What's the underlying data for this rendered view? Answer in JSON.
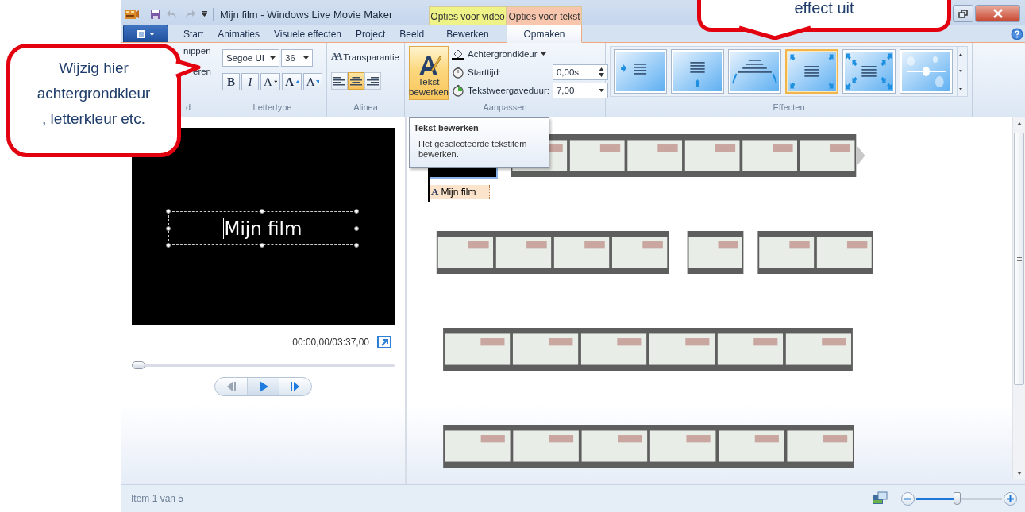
{
  "window": {
    "title": "Mijn film - Windows Live Movie Maker"
  },
  "context_tabs": [
    {
      "label": "Opties voor video",
      "color": "#eef287"
    },
    {
      "label": "Opties voor tekst",
      "color": "#f7c6ad"
    }
  ],
  "tabs": [
    {
      "label": "Start",
      "selected": false
    },
    {
      "label": "Animaties",
      "selected": false
    },
    {
      "label": "Visuele effecten",
      "selected": false
    },
    {
      "label": "Project",
      "selected": false
    },
    {
      "label": "Beeld",
      "selected": false
    },
    {
      "label": "Bewerken",
      "selected": false
    },
    {
      "label": "Opmaken",
      "selected": true
    }
  ],
  "ribbon": {
    "clipboard": {
      "commands": [
        "nippen",
        "eren"
      ],
      "label": "d"
    },
    "font": {
      "family": "Segoe UI",
      "size": "36",
      "format_buttons": [
        {
          "kind": "bold",
          "glyph": "B"
        },
        {
          "kind": "italic",
          "glyph": "I"
        },
        {
          "kind": "font-color",
          "glyph": "A"
        },
        {
          "kind": "grow",
          "glyph": "A"
        },
        {
          "kind": "shrink",
          "glyph": "A"
        }
      ],
      "label": "Lettertype"
    },
    "paragraph": {
      "transparency": {
        "icon": "AA",
        "label": "Transparantie"
      },
      "alignments": [
        {
          "kind": "left",
          "selected": false
        },
        {
          "kind": "center",
          "selected": true
        },
        {
          "kind": "right",
          "selected": false
        }
      ],
      "label": "Alinea"
    },
    "adjust": {
      "edit_text": {
        "label": "Tekst bewerken",
        "highlighted": true
      },
      "background_color": "Achtergrondkleur",
      "start_label": "Starttijd:",
      "start_value": "0,00s",
      "duration_label": "Tekstweergaveduur:",
      "duration_value": "7,00",
      "label": "Aanpassen"
    },
    "effects": {
      "items": [
        {
          "kind": "fly-in",
          "selected": false
        },
        {
          "kind": "rise",
          "selected": false
        },
        {
          "kind": "arch",
          "selected": false
        },
        {
          "kind": "zoom-in",
          "selected": true
        },
        {
          "kind": "zoom-out",
          "selected": false
        },
        {
          "kind": "sparkle",
          "selected": false
        }
      ],
      "label": "Effecten"
    }
  },
  "tooltip": {
    "title": "Tekst bewerken",
    "text": "Het geselecteerde tekstitem bewerken."
  },
  "preview": {
    "overlay_text": "Mijn film",
    "time": "00:00,00/03:37,00",
    "seek": {
      "level": 0
    }
  },
  "storyboard": {
    "rows": [
      {
        "clips": [
          {
            "kind": "title",
            "selected": true,
            "caption_icon": "A",
            "caption": "Mijn film"
          },
          {
            "kind": "video",
            "selected": false
          }
        ]
      },
      {
        "clips": [
          {
            "kind": "video",
            "selected": false
          },
          {
            "kind": "video",
            "selected": false
          },
          {
            "kind": "video",
            "selected": false
          }
        ]
      },
      {
        "clips": [
          {
            "kind": "video",
            "selected": false
          }
        ]
      },
      {
        "clips": [
          {
            "kind": "video",
            "selected": false
          }
        ]
      }
    ]
  },
  "status_bar": {
    "text": "Item 1 van 5",
    "zoom": {
      "level": 0.47
    }
  },
  "callouts": [
    {
      "text": "Wijzig hier\nachtergrondkleur\n, letterkleur etc."
    },
    {
      "text": "effect uit"
    }
  ]
}
